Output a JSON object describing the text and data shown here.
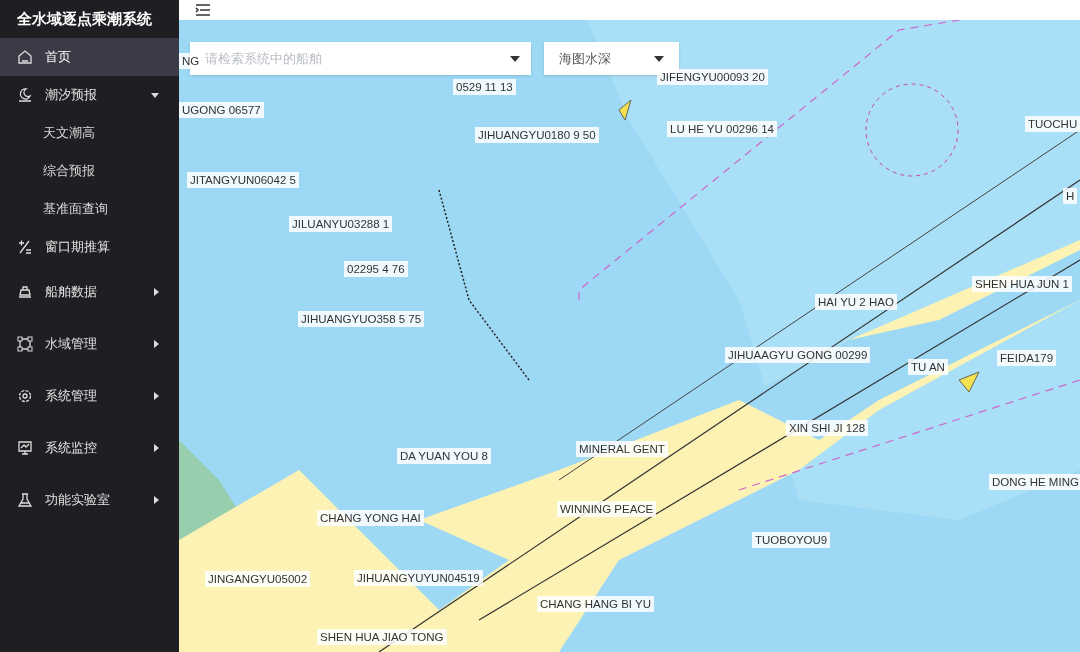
{
  "app_title": "全水域逐点乘潮系统",
  "sidebar": {
    "items": [
      {
        "label": "首页",
        "selected": true
      },
      {
        "label": "潮汐预报",
        "selected": false,
        "expanded": true,
        "children": [
          {
            "label": "天文潮高"
          },
          {
            "label": "综合预报"
          },
          {
            "label": "基准面查询"
          }
        ]
      },
      {
        "label": "窗口期推算",
        "selected": false
      },
      {
        "label": "船舶数据",
        "selected": false,
        "expanded": false
      },
      {
        "label": "水域管理",
        "selected": false,
        "expanded": false
      },
      {
        "label": "系统管理",
        "selected": false,
        "expanded": false
      },
      {
        "label": "系统监控",
        "selected": false,
        "expanded": false
      },
      {
        "label": "功能实验室",
        "selected": false,
        "expanded": false
      }
    ]
  },
  "map": {
    "search": {
      "placeholder": "请检索系统中的船舶"
    },
    "layer_select": {
      "value": "海图水深"
    },
    "ship_labels": [
      "NG",
      "UGONG 06577",
      "0529 11 13",
      "JIFENGYU00093 20",
      "JIHUANGYU0180 9 50",
      "LU HE YU 00296 14",
      "JITANGYUN06042 5",
      "JILUANYU03288 1",
      "02295 4 76",
      "JIHUANGYUO358 5 75",
      "TUOCHU",
      "H",
      "SHEN HUA JUN 1",
      "HAI YU 2 HAO",
      "JIHUAAGYU GONG 00299",
      "TU AN",
      "FEIDA179",
      "XIN SHI JI 128",
      "DA YUAN YOU 8",
      "MINERAL GENT",
      "WINNING PEACE",
      "DONG HE MING",
      "CHANG YONG HAI",
      "TUOBOYOU9",
      "JINGANGYU05002",
      "JIHUANGYUYUN04519",
      "CHANG HANG BI YU",
      "SHEN HUA JIAO TONG"
    ]
  }
}
